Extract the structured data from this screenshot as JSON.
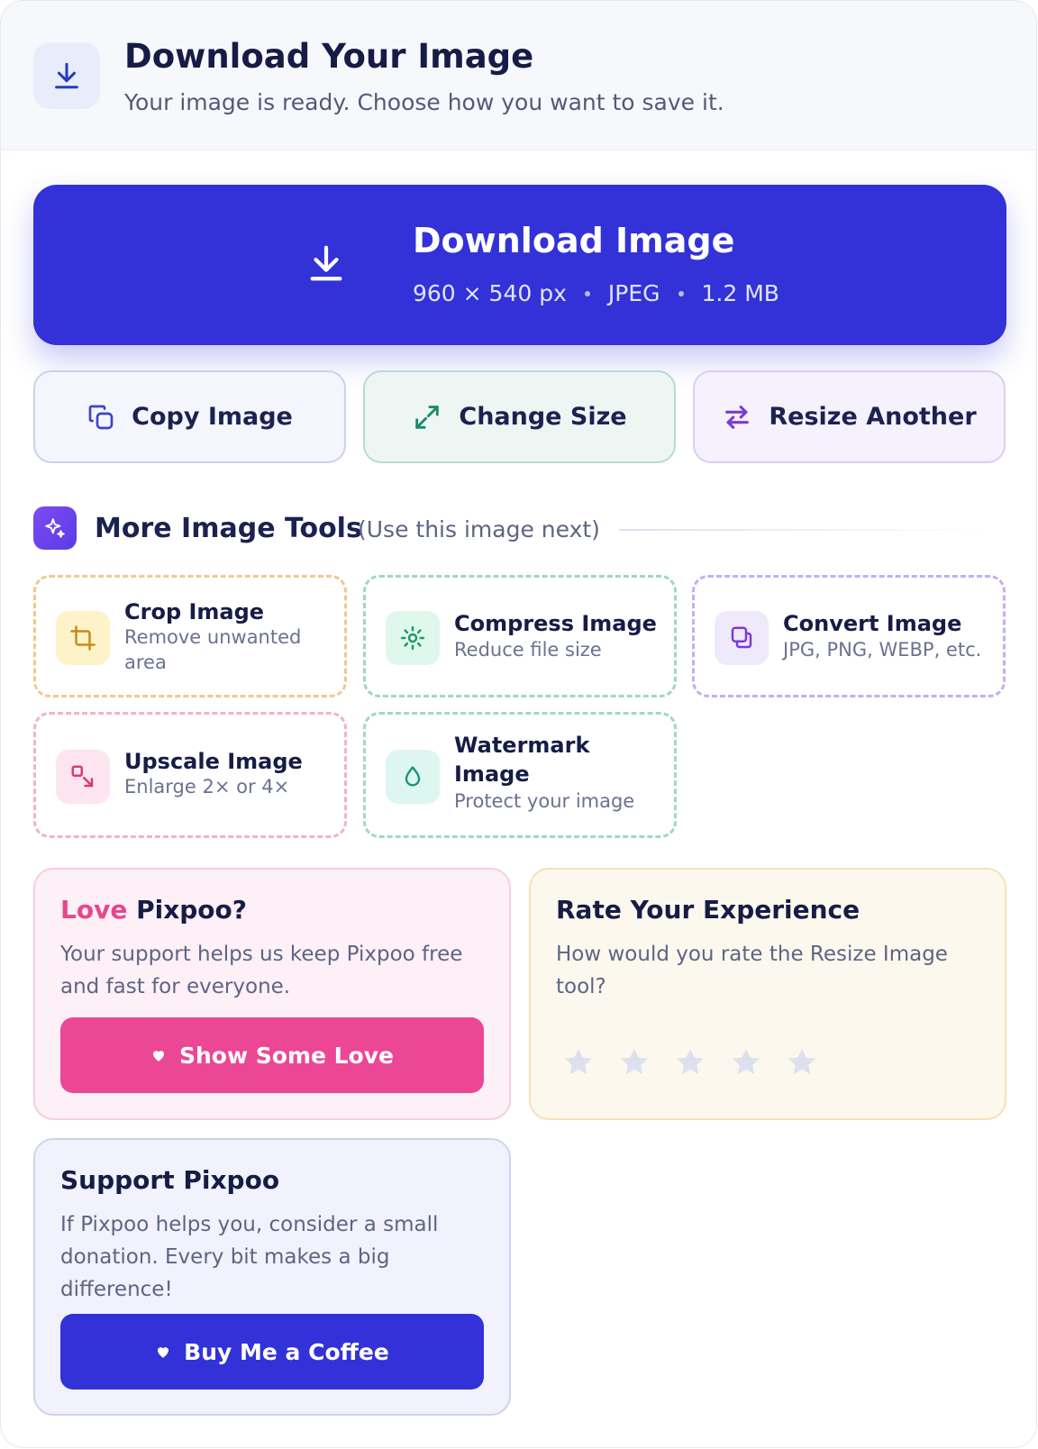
{
  "header": {
    "title": "Download Your Image",
    "subtitle": "Your image is ready. Choose how you want to save it.",
    "icon": "download-icon"
  },
  "download": {
    "title": "Download Image",
    "dimensions": "960 × 540 px",
    "format": "JPEG",
    "size": "1.2 MB",
    "color": "#3232d8"
  },
  "actions": {
    "copy": "Copy Image",
    "change_size": "Change Size",
    "resize_another": "Resize Another"
  },
  "tools": {
    "title": "More Image Tools",
    "subtitle": "(Use this image next)",
    "items": [
      {
        "name": "Crop Image",
        "desc": "Remove unwanted area",
        "icon": "crop-icon"
      },
      {
        "name": "Compress Image",
        "desc": "Reduce file size",
        "icon": "compress-icon"
      },
      {
        "name": "Convert Image",
        "desc": "JPG, PNG, WEBP, etc.",
        "icon": "convert-icon"
      },
      {
        "name": "Upscale Image",
        "desc": "Enlarge 2× or 4×",
        "icon": "upscale-icon"
      },
      {
        "name": "Watermark Image",
        "desc": "Protect your image",
        "icon": "droplet-icon"
      }
    ]
  },
  "love": {
    "title_accent": "Love",
    "title_rest": " Pixpoo?",
    "text": "Your support helps us keep Pixpoo free and fast for everyone.",
    "button": "Show Some Love",
    "accent": "#ec4795"
  },
  "rate": {
    "title": "Rate Your Experience",
    "text": "How would you rate the Resize Image tool?",
    "stars_total": 5,
    "stars_selected": 0
  },
  "support": {
    "title": "Support Pixpoo",
    "text": "If Pixpoo helps you, consider a small donation. Every bit makes a big difference!",
    "button": "Buy Me a Coffee"
  }
}
